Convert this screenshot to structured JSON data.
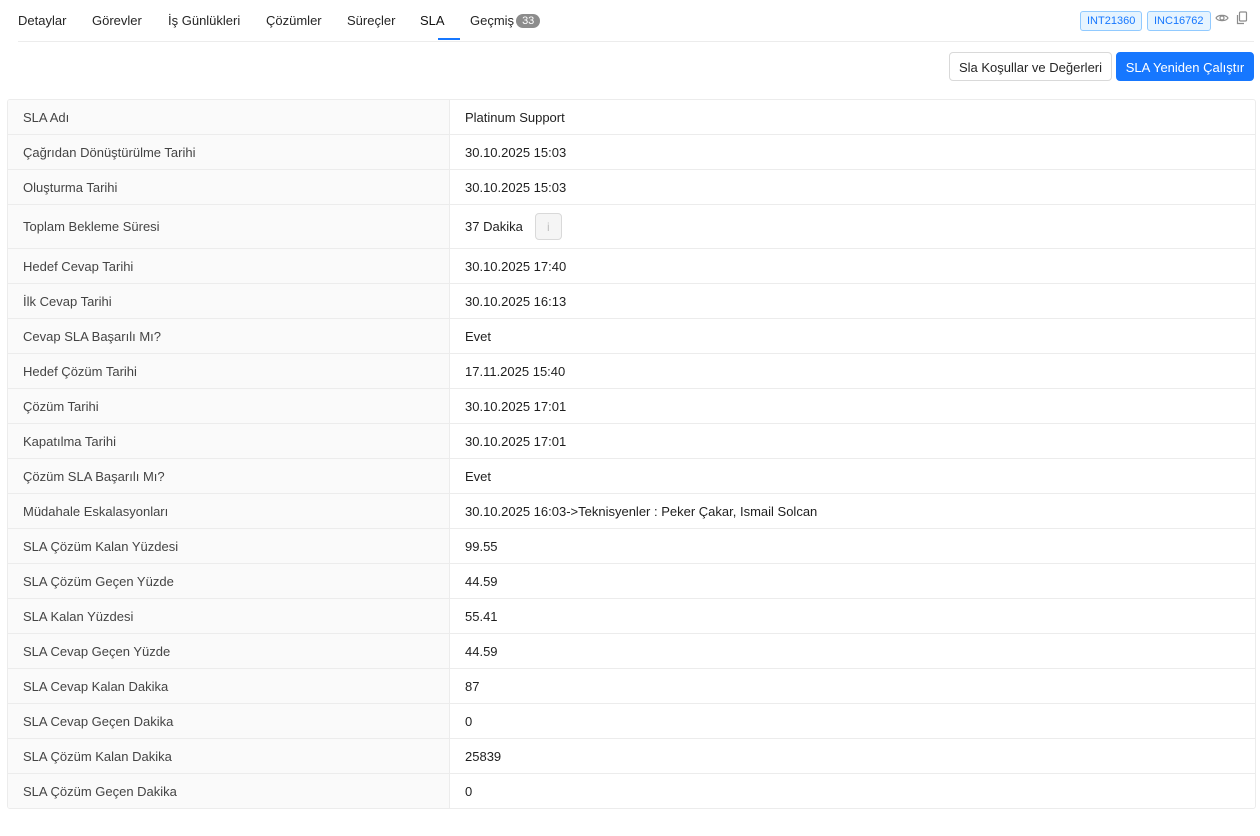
{
  "tabs": [
    {
      "label": "Detaylar"
    },
    {
      "label": "Görevler"
    },
    {
      "label": "İş Günlükleri"
    },
    {
      "label": "Çözümler"
    },
    {
      "label": "Süreçler"
    },
    {
      "label": "SLA"
    },
    {
      "label": "Geçmiş",
      "count": "33"
    }
  ],
  "active_tab": "SLA",
  "ids": {
    "int": "INT21360",
    "inc": "INC16762"
  },
  "icons": {
    "watch": "eye-icon",
    "copy": "copy-icon",
    "info": "info-icon"
  },
  "actions": {
    "conditions_label": "Sla Koşullar ve Değerleri",
    "rerun_label": "SLA Yeniden Çalıştır"
  },
  "colors": {
    "primary": "#1677ff",
    "label_bg": "#fafafa"
  },
  "sla_rows": [
    {
      "label": "SLA Adı",
      "value": "Platinum Support"
    },
    {
      "label": "Çağrıdan Dönüştürülme Tarihi",
      "value": "30.10.2025 15:03"
    },
    {
      "label": "Oluşturma Tarihi",
      "value": "30.10.2025 15:03"
    },
    {
      "label": "Toplam Bekleme Süresi",
      "value": "37 Dakika"
    },
    {
      "label": "Hedef Cevap Tarihi",
      "value": "30.10.2025 17:40"
    },
    {
      "label": "İlk Cevap Tarihi",
      "value": "30.10.2025 16:13"
    },
    {
      "label": "Cevap SLA Başarılı Mı?",
      "value": "Evet"
    },
    {
      "label": "Hedef Çözüm Tarihi",
      "value": "17.11.2025 15:40"
    },
    {
      "label": "Çözüm Tarihi",
      "value": "30.10.2025 17:01"
    },
    {
      "label": "Kapatılma Tarihi",
      "value": "30.10.2025 17:01"
    },
    {
      "label": "Çözüm SLA Başarılı Mı?",
      "value": "Evet"
    },
    {
      "label": "Müdahale Eskalasyonları",
      "value": "30.10.2025 16:03->Teknisyenler : Peker Çakar, Ismail Solcan"
    },
    {
      "label": "SLA Çözüm Kalan Yüzdesi",
      "value": "99.55"
    },
    {
      "label": "SLA Çözüm Geçen Yüzde",
      "value": "44.59"
    },
    {
      "label": "SLA Kalan Yüzdesi",
      "value": "55.41"
    },
    {
      "label": "SLA Cevap Geçen Yüzde",
      "value": "44.59"
    },
    {
      "label": "SLA Cevap Kalan Dakika",
      "value": "87"
    },
    {
      "label": "SLA Cevap Geçen Dakika",
      "value": "0"
    },
    {
      "label": "SLA Çözüm Kalan Dakika",
      "value": "25839"
    },
    {
      "label": "SLA Çözüm Geçen Dakika",
      "value": "0"
    }
  ]
}
